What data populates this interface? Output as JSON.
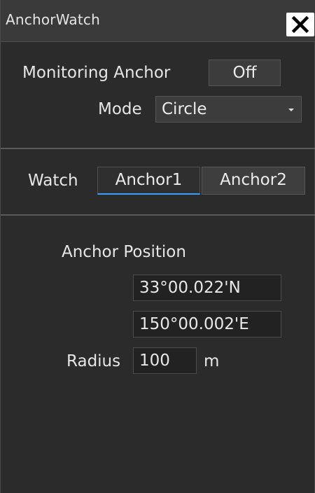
{
  "window": {
    "title": "AnchorWatch"
  },
  "monitoring": {
    "label": "Monitoring Anchor",
    "toggle_value": "Off",
    "mode_label": "Mode",
    "mode_value": "Circle"
  },
  "watch": {
    "label": "Watch",
    "tabs": [
      {
        "label": "Anchor1",
        "selected": true
      },
      {
        "label": "Anchor2",
        "selected": false
      }
    ]
  },
  "anchor_position": {
    "heading": "Anchor Position",
    "latitude": "33°00.022'N",
    "longitude": "150°00.002'E"
  },
  "radius": {
    "label": "Radius",
    "value": "100",
    "unit": "m"
  },
  "icons": {
    "close": "close-icon",
    "dropdown": "chevron-down-icon"
  },
  "colors": {
    "panel_bg": "#2b2b2b",
    "tab_accent": "#3aa0ff",
    "close_bg": "#ffffff"
  }
}
